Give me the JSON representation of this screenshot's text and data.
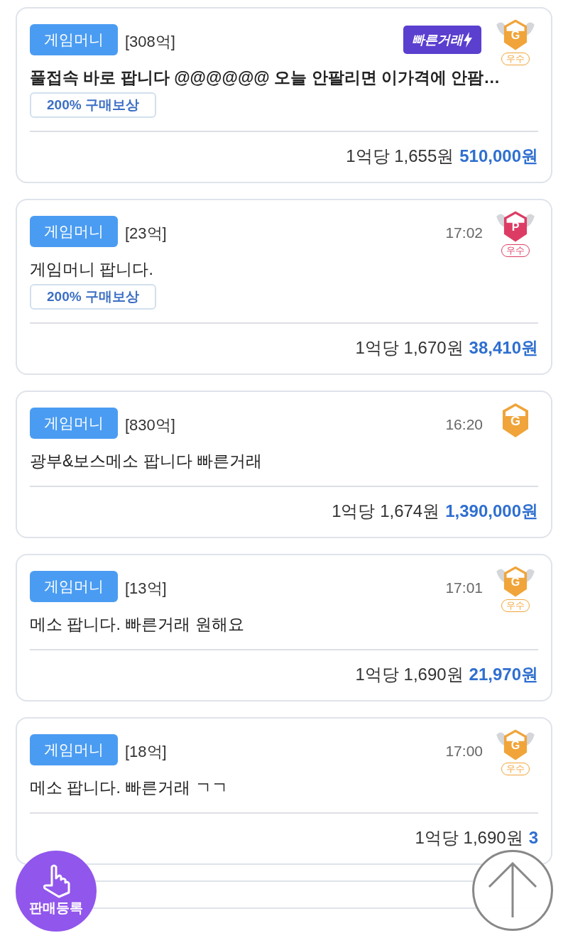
{
  "listings": [
    {
      "category": "게임머니",
      "amount": "[308억]",
      "quick_badge": "빠른거래",
      "grade": {
        "letter": "G",
        "color": "#f0a43a",
        "winged": true,
        "label": "우수"
      },
      "title": "풀접속 바로 팝니다 @@@@@@ 오늘 안팔리면 이가격에 안팜…",
      "title_bold": true,
      "reward": "200% 구매보상",
      "unit_price": "1억당 1,655원",
      "total": "510,000원"
    },
    {
      "category": "게임머니",
      "amount": "[23억]",
      "time": "17:02",
      "grade": {
        "letter": "P",
        "color": "#dc3c64",
        "winged": true,
        "label": "우수"
      },
      "title": "게임머니 팝니다.",
      "title_bold": false,
      "reward": "200% 구매보상",
      "unit_price": "1억당 1,670원",
      "total": "38,410원"
    },
    {
      "category": "게임머니",
      "amount": "[830억]",
      "time": "16:20",
      "grade": {
        "letter": "G",
        "color": "#f0a43a",
        "winged": false
      },
      "title": "광부&보스메소 팝니다 빠른거래",
      "title_bold": false,
      "unit_price": "1억당 1,674원",
      "total": "1,390,000원"
    },
    {
      "category": "게임머니",
      "amount": "[13억]",
      "time": "17:01",
      "grade": {
        "letter": "G",
        "color": "#f0a43a",
        "winged": true,
        "label": "우수"
      },
      "title": "메소 팝니다. 빠른거래 원해요",
      "title_bold": false,
      "unit_price": "1억당 1,690원",
      "total": "21,970원"
    },
    {
      "category": "게임머니",
      "amount": "[18억]",
      "time": "17:00",
      "grade": {
        "letter": "G",
        "color": "#f0a43a",
        "winged": true,
        "label": "우수"
      },
      "title": "메소 팝니다. 빠른거래 ㄱㄱ",
      "title_bold": false,
      "unit_price": "1억당 1,690원",
      "total": "3"
    }
  ],
  "sell_button": {
    "label": "판매등록"
  }
}
